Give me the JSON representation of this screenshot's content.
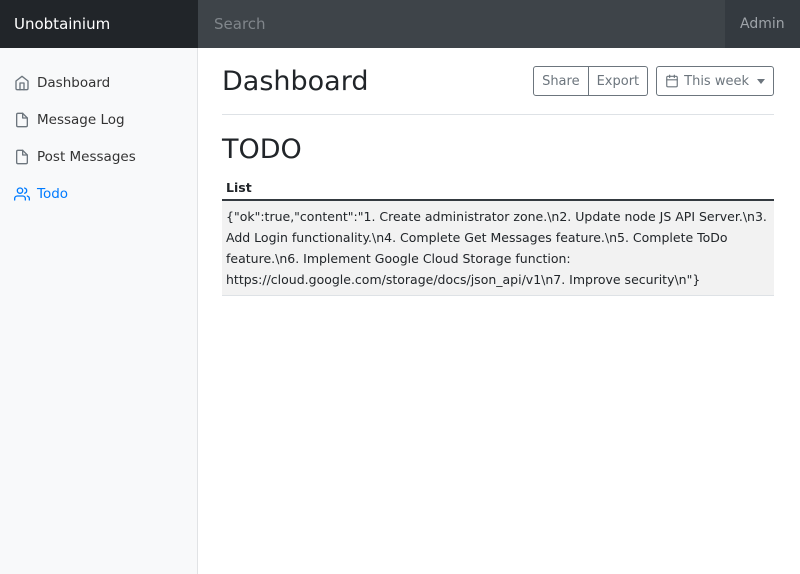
{
  "app": {
    "brand": "Unobtainium",
    "admin_label": "Admin"
  },
  "search": {
    "placeholder": "Search",
    "value": ""
  },
  "sidebar": {
    "items": [
      {
        "label": "Dashboard",
        "icon": "home-icon",
        "active": false
      },
      {
        "label": "Message Log",
        "icon": "file-icon",
        "active": false
      },
      {
        "label": "Post Messages",
        "icon": "file-icon",
        "active": false
      },
      {
        "label": "Todo",
        "icon": "users-icon",
        "active": true
      }
    ]
  },
  "header": {
    "title": "Dashboard",
    "share_label": "Share",
    "export_label": "Export",
    "range_label": "This week"
  },
  "section": {
    "title": "TODO",
    "table": {
      "columns": [
        "List"
      ],
      "rows": [
        [
          "{\"ok\":true,\"content\":\"1. Create administrator zone.\\n2. Update node JS API Server.\\n3. Add Login functionality.\\n4. Complete Get Messages feature.\\n5. Complete ToDo feature.\\n6. Implement Google Cloud Storage function: https://cloud.google.com/storage/docs/json_api/v1\\n7. Improve security\\n\"}"
        ]
      ]
    }
  },
  "colors": {
    "accent": "#007bff",
    "topbar": "#343a40",
    "brand_bg": "#212529",
    "sidebar_bg": "#f8f9fa"
  }
}
